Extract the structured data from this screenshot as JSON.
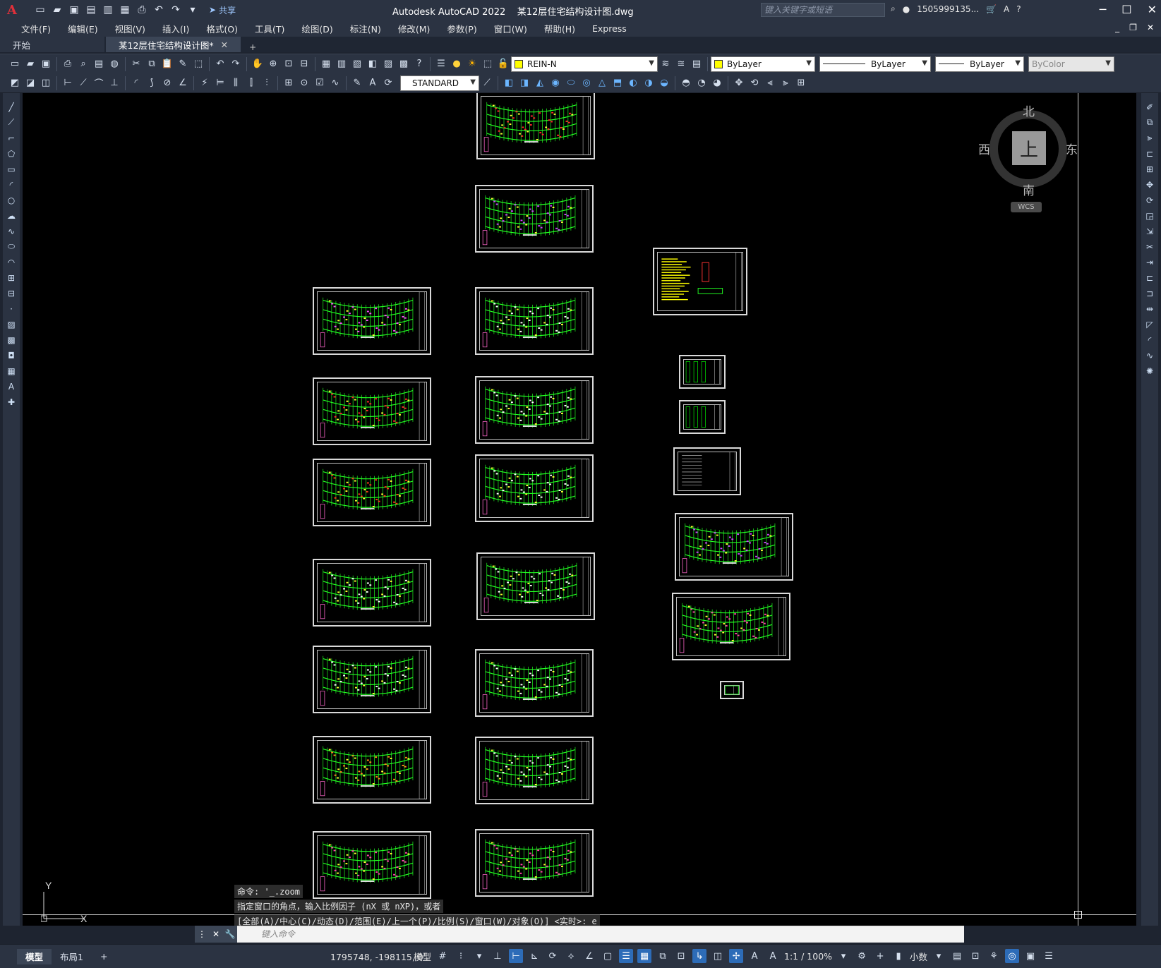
{
  "app": {
    "logo": "A",
    "title": "Autodesk AutoCAD 2022",
    "document": "某12层住宅结构设计图.dwg",
    "share_label": "共享",
    "search_placeholder": "键入关键字或短语",
    "user": "1505999135..."
  },
  "menu": [
    "文件(F)",
    "编辑(E)",
    "视图(V)",
    "插入(I)",
    "格式(O)",
    "工具(T)",
    "绘图(D)",
    "标注(N)",
    "修改(M)",
    "参数(P)",
    "窗口(W)",
    "帮助(H)",
    "Express"
  ],
  "tabs": [
    {
      "label": "开始"
    },
    {
      "label": "某12层住宅结构设计图*"
    }
  ],
  "toolbar": {
    "layer": "REIN-N",
    "layer_color": "#ffff00",
    "color_combo": "ByLayer",
    "linetype_combo": "ByLayer",
    "lineweight_combo": "ByLayer",
    "plotstyle_combo": "ByColor",
    "text_style": "STANDARD"
  },
  "viewcube": {
    "top": "上",
    "north": "北",
    "south": "南",
    "east": "东",
    "west": "西",
    "wcs": "WCS"
  },
  "ucs": {
    "y": "Y",
    "x": "X"
  },
  "command": {
    "history": [
      "命令: '_.zoom",
      "指定窗口的角点，输入比例因子 (nX 或 nXP)，或者",
      "[全部(A)/中心(C)/动态(D)/范围(E)/上一个(P)/比例(S)/窗口(W)/对象(O)] <实时>:  e"
    ],
    "placeholder": "键入命令"
  },
  "status": {
    "layout_tabs": [
      "模型",
      "布局1"
    ],
    "coordinates": "1795748, -198115, 0",
    "mode": "模型",
    "scale": "1:1 / 100%",
    "units": "小数"
  }
}
